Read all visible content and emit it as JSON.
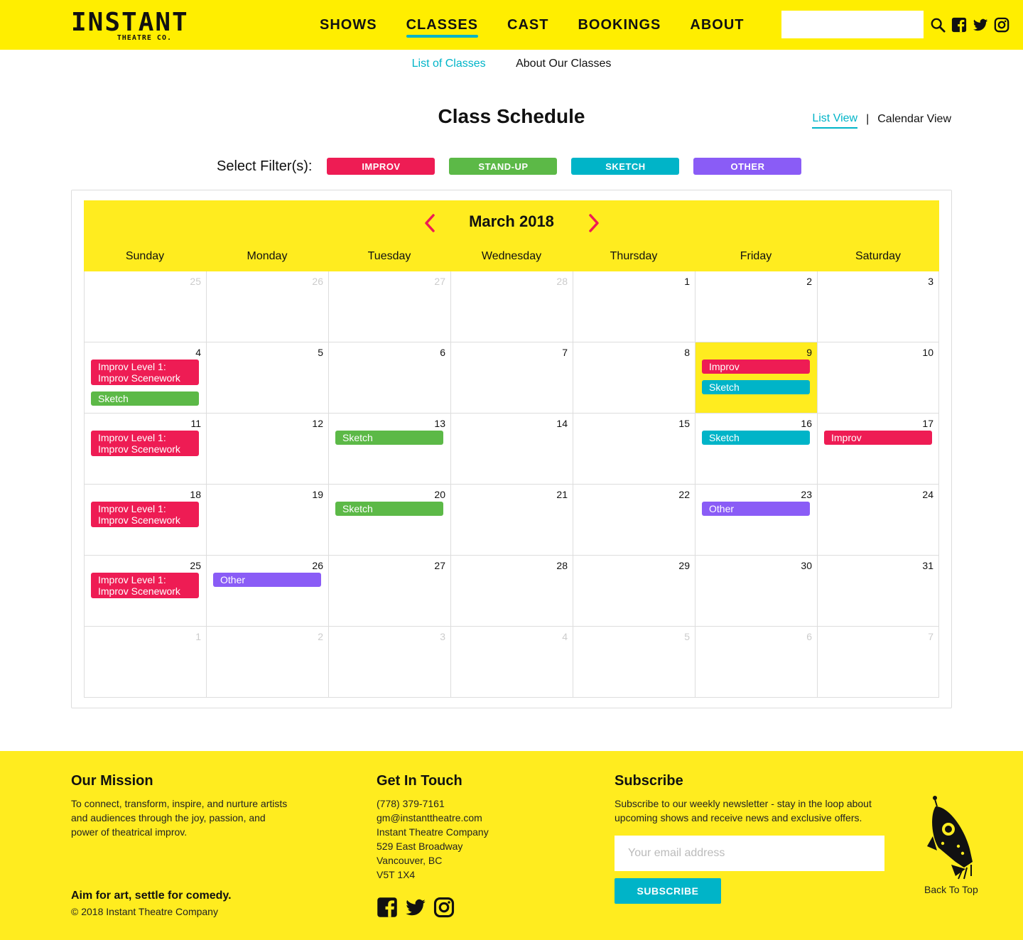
{
  "header": {
    "logo_main": "INSTANT",
    "logo_sub": "THEATRE CO.",
    "nav": [
      "SHOWS",
      "CLASSES",
      "CAST",
      "BOOKINGS",
      "ABOUT"
    ],
    "active_nav": "CLASSES",
    "search_placeholder": "",
    "icons": [
      "search-icon",
      "facebook-icon",
      "twitter-icon",
      "instagram-icon"
    ]
  },
  "subnav": {
    "items": [
      "List of Classes",
      "About Our Classes"
    ],
    "active": "List of Classes"
  },
  "page": {
    "title": "Class Schedule",
    "list_view": "List View",
    "separator": "|",
    "calendar_view": "Calendar View",
    "active_view": "List View"
  },
  "filters": {
    "label": "Select Filter(s):",
    "items": [
      {
        "label": "IMPROV",
        "color": "#ee1c54"
      },
      {
        "label": "STAND-UP",
        "color": "#5cb947"
      },
      {
        "label": "SKETCH",
        "color": "#00b4c8"
      },
      {
        "label": "OTHER",
        "color": "#8a5cf6"
      }
    ]
  },
  "calendar": {
    "month": "March 2018",
    "weekdays": [
      "Sunday",
      "Monday",
      "Tuesday",
      "Wednesday",
      "Thursday",
      "Friday",
      "Saturday"
    ],
    "weeks": [
      [
        {
          "d": "25",
          "muted": true
        },
        {
          "d": "26",
          "muted": true
        },
        {
          "d": "27",
          "muted": true
        },
        {
          "d": "28",
          "muted": true
        },
        {
          "d": "1"
        },
        {
          "d": "2"
        },
        {
          "d": "3"
        }
      ],
      [
        {
          "d": "4",
          "events": [
            {
              "t": "Improv Level 1: Improv Scenework",
              "c": "improv"
            },
            {
              "t": "Sketch",
              "c": "standup"
            }
          ]
        },
        {
          "d": "5"
        },
        {
          "d": "6"
        },
        {
          "d": "7"
        },
        {
          "d": "8"
        },
        {
          "d": "9",
          "today": true,
          "events": [
            {
              "t": "Improv",
              "c": "improv"
            },
            {
              "t": "Sketch",
              "c": "sketch"
            }
          ]
        },
        {
          "d": "10"
        }
      ],
      [
        {
          "d": "11",
          "events": [
            {
              "t": "Improv Level 1: Improv Scenework",
              "c": "improv"
            }
          ]
        },
        {
          "d": "12"
        },
        {
          "d": "13",
          "events": [
            {
              "t": "Sketch",
              "c": "standup"
            }
          ]
        },
        {
          "d": "14"
        },
        {
          "d": "15"
        },
        {
          "d": "16",
          "events": [
            {
              "t": "Sketch",
              "c": "sketch"
            }
          ]
        },
        {
          "d": "17",
          "events": [
            {
              "t": "Improv",
              "c": "improv"
            }
          ]
        }
      ],
      [
        {
          "d": "18",
          "events": [
            {
              "t": "Improv Level 1: Improv Scenework",
              "c": "improv"
            }
          ]
        },
        {
          "d": "19"
        },
        {
          "d": "20",
          "events": [
            {
              "t": "Sketch",
              "c": "standup"
            }
          ]
        },
        {
          "d": "21"
        },
        {
          "d": "22"
        },
        {
          "d": "23",
          "events": [
            {
              "t": "Other",
              "c": "other"
            }
          ]
        },
        {
          "d": "24"
        }
      ],
      [
        {
          "d": "25",
          "events": [
            {
              "t": "Improv Level 1: Improv Scenework",
              "c": "improv"
            }
          ]
        },
        {
          "d": "26",
          "events": [
            {
              "t": "Other",
              "c": "other"
            }
          ]
        },
        {
          "d": "27"
        },
        {
          "d": "28"
        },
        {
          "d": "29"
        },
        {
          "d": "30"
        },
        {
          "d": "31"
        }
      ],
      [
        {
          "d": "1",
          "muted": true
        },
        {
          "d": "2",
          "muted": true
        },
        {
          "d": "3",
          "muted": true
        },
        {
          "d": "4",
          "muted": true
        },
        {
          "d": "5",
          "muted": true
        },
        {
          "d": "6",
          "muted": true
        },
        {
          "d": "7",
          "muted": true
        }
      ]
    ],
    "colors": {
      "improv": "#ee1c54",
      "standup": "#5cb947",
      "sketch": "#00b4c8",
      "other": "#8a5cf6",
      "today": "#ffec1f"
    }
  },
  "footer": {
    "mission_title": "Our Mission",
    "mission_text": "To connect, transform, inspire, and nurture artists and audiences through the joy, passion, and power of theatrical improv.",
    "tagline": "Aim for art, settle for comedy.",
    "copyright": "© 2018 Instant Theatre Company",
    "contact_title": "Get In Touch",
    "contact_lines": [
      "(778) 379-7161",
      "gm@instanttheatre.com",
      "Instant Theatre Company",
      "529 East Broadway",
      "Vancouver, BC",
      "V5T 1X4"
    ],
    "subscribe_title": "Subscribe",
    "subscribe_text": "Subscribe to our weekly newsletter - stay in the loop about upcoming shows and receive news and exclusive offers.",
    "email_placeholder": "Your email address",
    "subscribe_button": "SUBSCRIBE",
    "back_to_top": "Back To Top"
  }
}
